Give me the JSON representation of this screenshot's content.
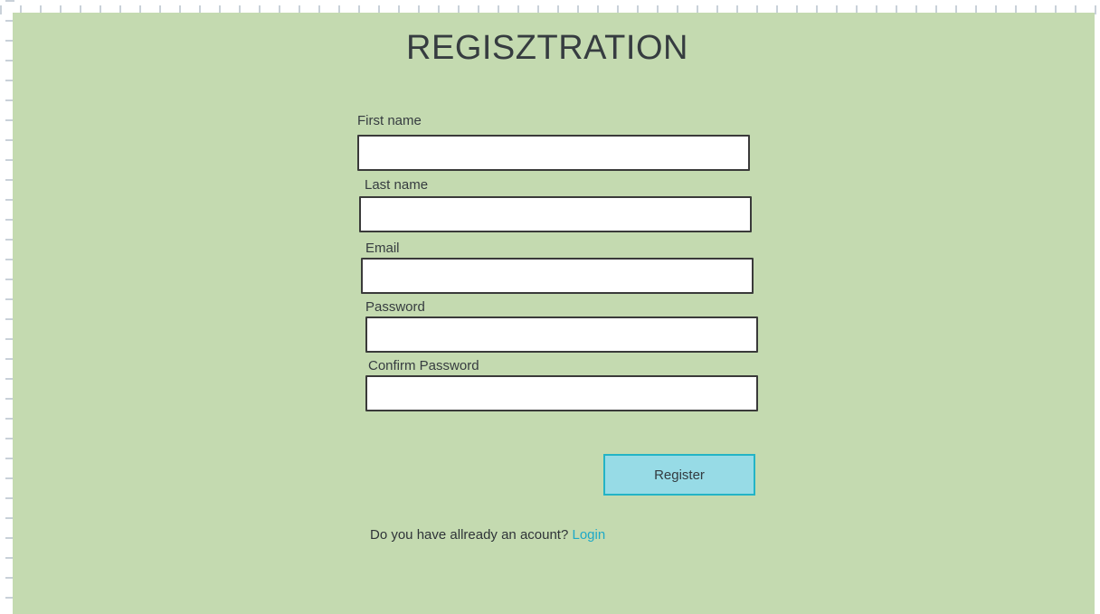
{
  "page": {
    "title": "REGISZTRATION"
  },
  "form": {
    "first_name": {
      "label": "First name",
      "value": "",
      "placeholder": ""
    },
    "last_name": {
      "label": "Last name",
      "value": "",
      "placeholder": ""
    },
    "email": {
      "label": "Email",
      "value": "",
      "placeholder": ""
    },
    "password": {
      "label": "Password",
      "value": "",
      "placeholder": ""
    },
    "confirm_password": {
      "label": "Confirm Password",
      "value": "",
      "placeholder": ""
    },
    "register_label": "Register"
  },
  "footer": {
    "prompt": "Do you have allready an acount?",
    "login_label": "Login"
  },
  "colors": {
    "background": "#c4dab0",
    "button_fill": "#97dbe6",
    "button_border": "#23b4c6",
    "link": "#1ea9c7"
  }
}
